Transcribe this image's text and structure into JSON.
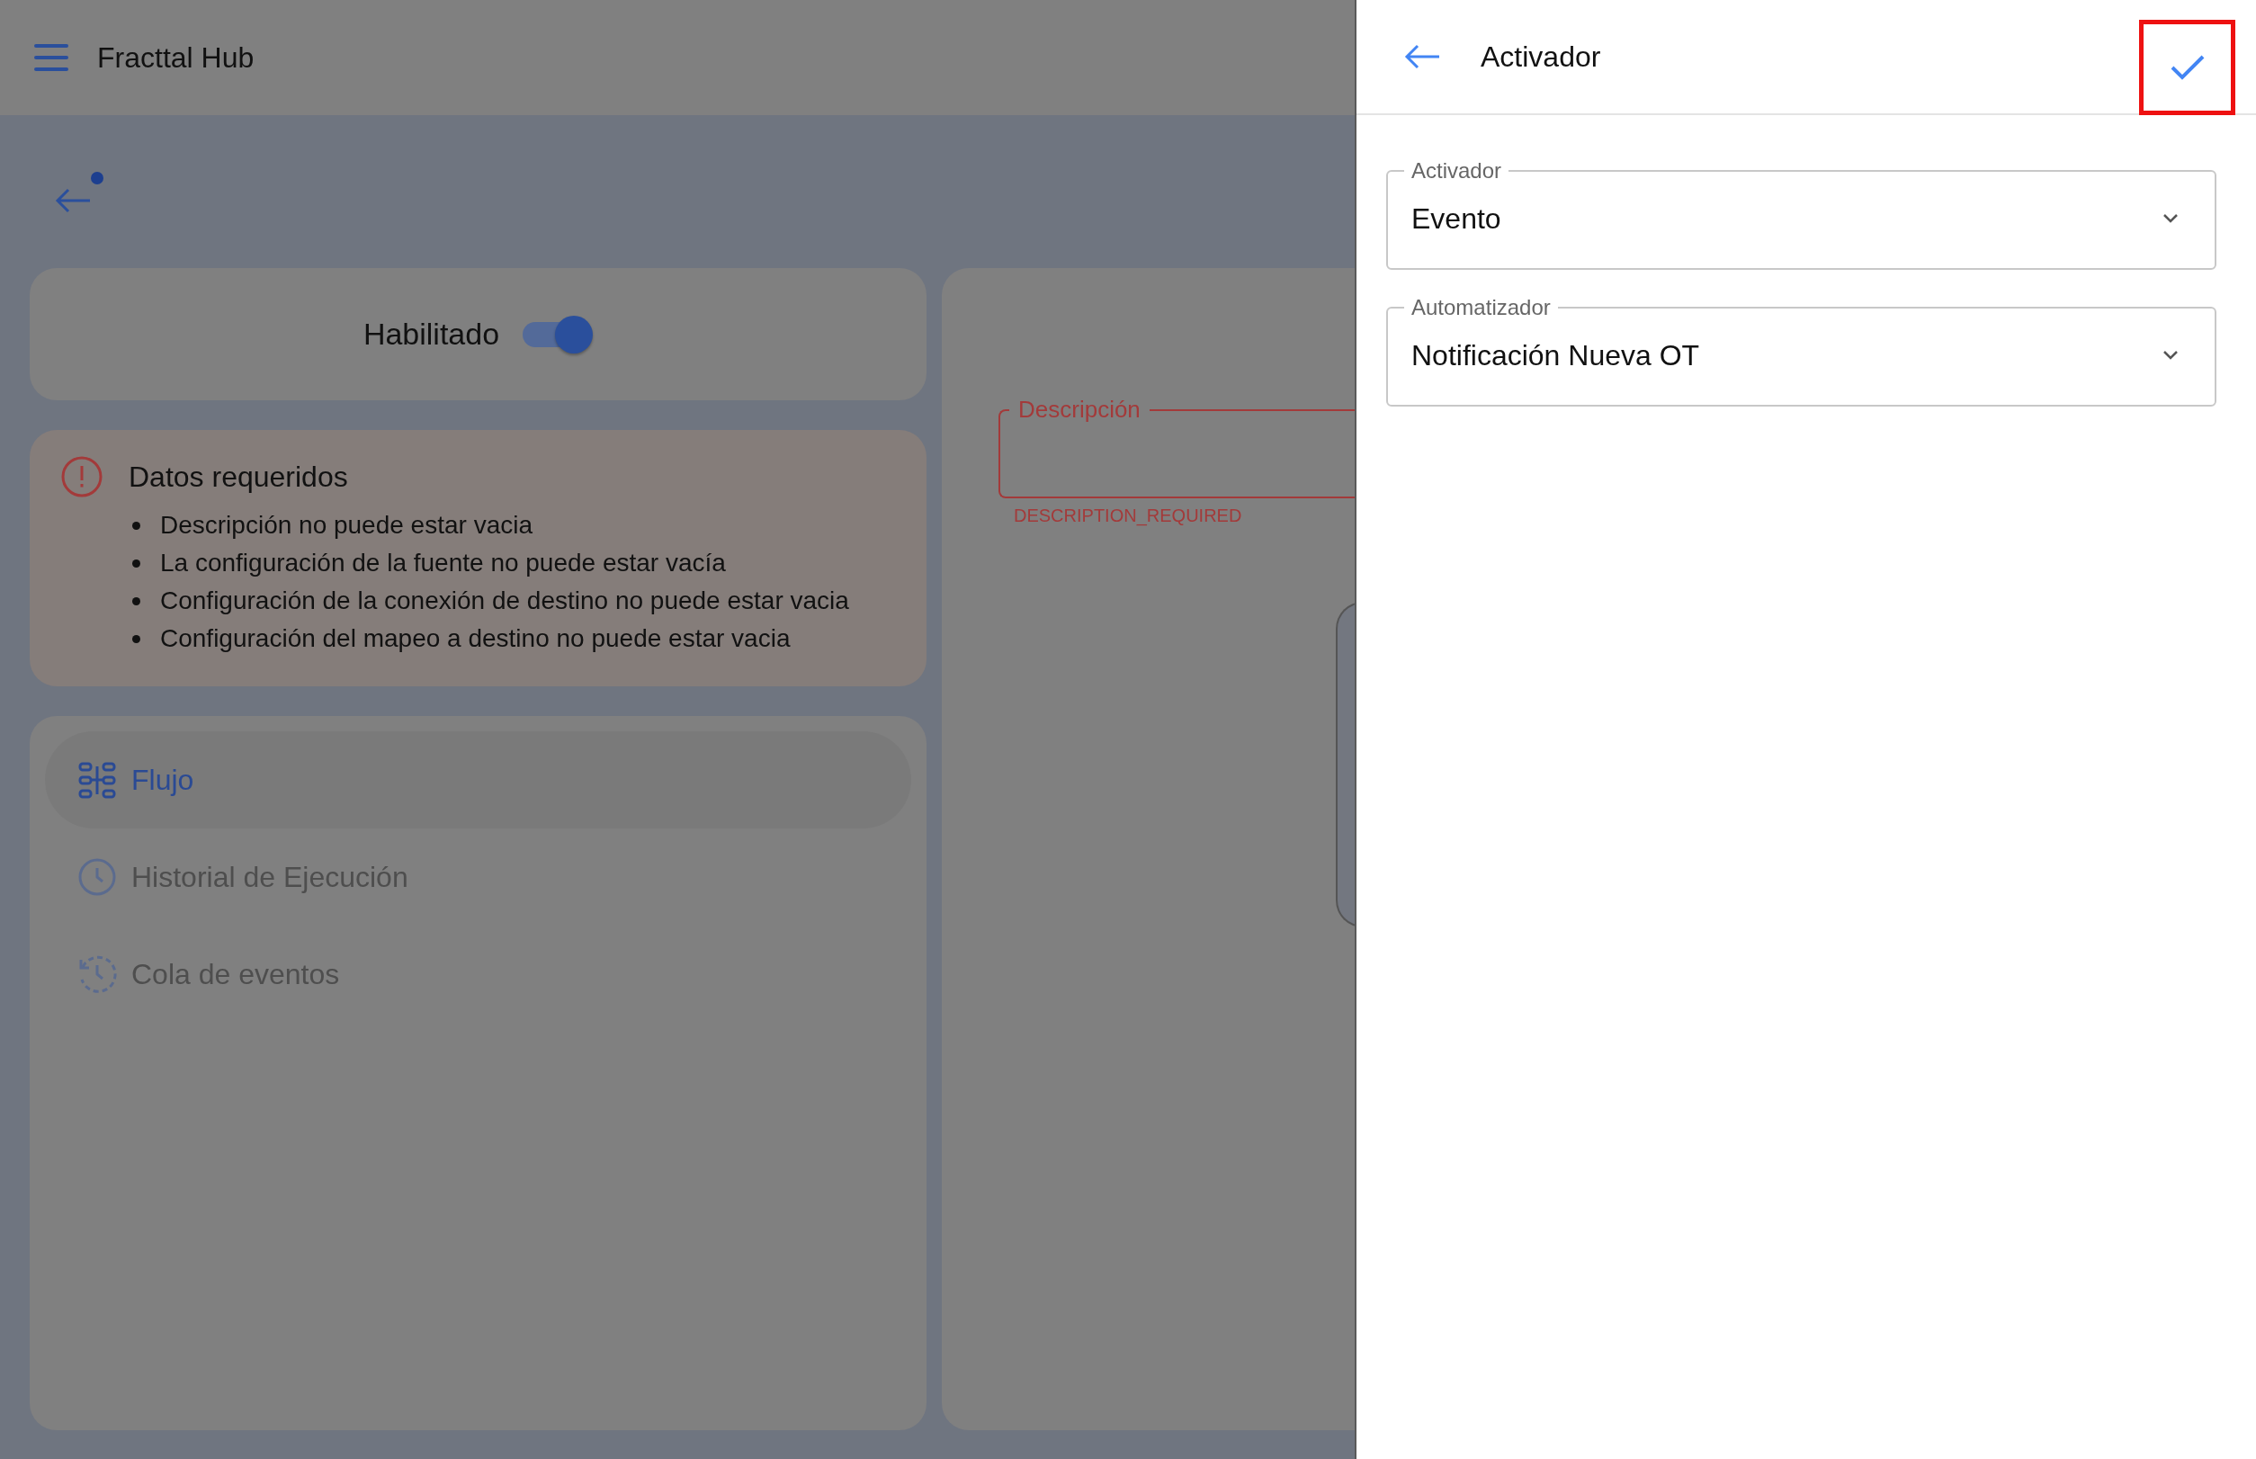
{
  "app_bar": {
    "title": "Fracttal Hub"
  },
  "status_card": {
    "label": "Habilitado",
    "on": true
  },
  "errors": {
    "title": "Datos requeridos",
    "items": [
      "Descripción no puede estar vacia",
      "La configuración de la fuente no puede estar vacía",
      "Configuración de la conexión de destino no puede estar vacia",
      "Configuración del mapeo a destino no puede estar vacia"
    ]
  },
  "nav": [
    {
      "label": "Flujo",
      "kind": "flow",
      "selected": true
    },
    {
      "label": "Historial de Ejecución",
      "kind": "history",
      "selected": false
    },
    {
      "label": "Cola de eventos",
      "kind": "queue",
      "selected": false
    }
  ],
  "description_field": {
    "label": "Descripción",
    "error": "DESCRIPTION_REQUIRED"
  },
  "drawer": {
    "title": "Activador",
    "confirm_highlighted": true,
    "fields": [
      {
        "label": "Activador",
        "value": "Evento"
      },
      {
        "label": "Automatizador",
        "value": "Notificación Nueva OT"
      }
    ]
  }
}
